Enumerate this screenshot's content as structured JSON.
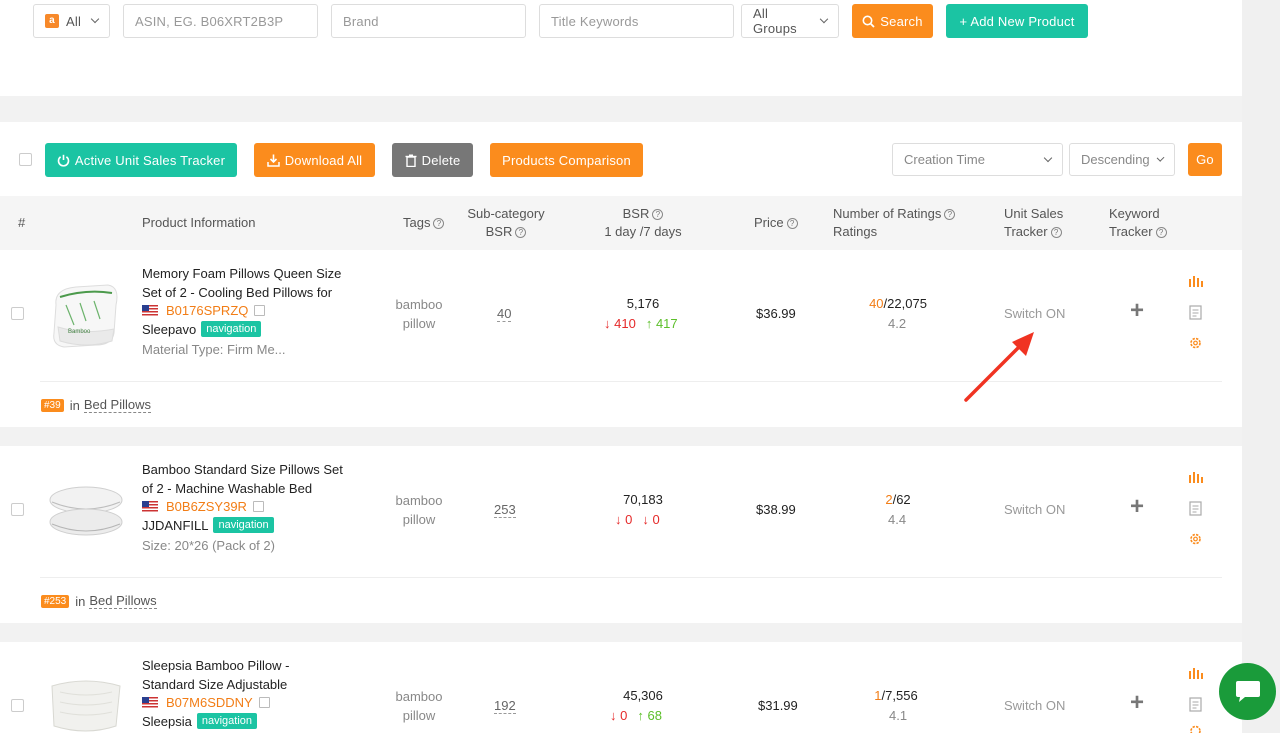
{
  "search": {
    "marketplace": "All",
    "asin_placeholder": "ASIN, EG. B06XRT2B3P",
    "brand_placeholder": "Brand",
    "keywords_placeholder": "Title Keywords",
    "groups": "All Groups",
    "search_label": "Search",
    "add_label": "+ Add New Product"
  },
  "toolbar": {
    "active_tracker_label": "Active Unit Sales Tracker",
    "download_label": "Download All",
    "delete_label": "Delete",
    "comparison_label": "Products Comparison",
    "sort_field": "Creation Time",
    "sort_order": "Descending",
    "go_label": "Go"
  },
  "table": {
    "headers": {
      "index": "#",
      "product": "Product Information",
      "tags": "Tags",
      "subcat_1": "Sub-category",
      "subcat_2": "BSR",
      "bsr_1": "BSR",
      "bsr_2": "1 day /7 days",
      "price": "Price",
      "ratings_1": "Number of Ratings",
      "ratings_2": "Ratings",
      "ust_1": "Unit Sales",
      "ust_2": "Tracker",
      "kt_1": "Keyword",
      "kt_2": "Tracker"
    },
    "rows": [
      {
        "title_1": "Memory Foam Pillows Queen Size",
        "title_2": "Set of 2 - Cooling Bed Pillows for",
        "asin": "B0176SPRZQ",
        "brand": "Sleepavo",
        "brand_tag": "navigation",
        "meta": "Material Type: Firm Me...",
        "tag_1": "bamboo",
        "tag_2": "pillow",
        "subcat_bsr": "40",
        "bsr": "5,176",
        "bsr_day": "410",
        "bsr_week": "417",
        "price": "$36.99",
        "ratings_new": "40",
        "ratings_total": "/22,075",
        "rating_avg": "4.2",
        "ust": "Switch ON",
        "rank": "#39",
        "rank_in": "in",
        "category": "Bed Pillows"
      },
      {
        "title_1": "Bamboo Standard Size Pillows Set",
        "title_2": "of 2 - Machine Washable Bed",
        "asin": "B0B6ZSY39R",
        "brand": "JJDANFILL",
        "brand_tag": "navigation",
        "meta": "Size: 20*26 (Pack of 2)",
        "tag_1": "bamboo",
        "tag_2": "pillow",
        "subcat_bsr": "253",
        "bsr": "70,183",
        "bsr_day": "0",
        "bsr_week": "0",
        "price": "$38.99",
        "ratings_new": "2",
        "ratings_total": "/62",
        "rating_avg": "4.4",
        "ust": "Switch ON",
        "rank": "#253",
        "rank_in": "in",
        "category": "Bed Pillows"
      },
      {
        "title_1": "Sleepsia Bamboo Pillow -",
        "title_2": "Standard Size Adjustable",
        "asin": "B07M6SDDNY",
        "brand": "Sleepsia",
        "brand_tag": "navigation",
        "tag_1": "bamboo",
        "tag_2": "pillow",
        "subcat_bsr": "192",
        "bsr": "45,306",
        "bsr_day": "0",
        "bsr_week": "68",
        "price": "$31.99",
        "ratings_new": "1",
        "ratings_total": "/7,556",
        "rating_avg": "4.1",
        "ust": "Switch ON"
      }
    ]
  },
  "colors": {
    "accent_orange": "#fb8c1d",
    "accent_green": "#1bc4a3",
    "down_red": "#e52a2a",
    "up_green": "#5cbf2a",
    "chat_green": "#1a9b3a",
    "annotation_red": "#f03322"
  }
}
